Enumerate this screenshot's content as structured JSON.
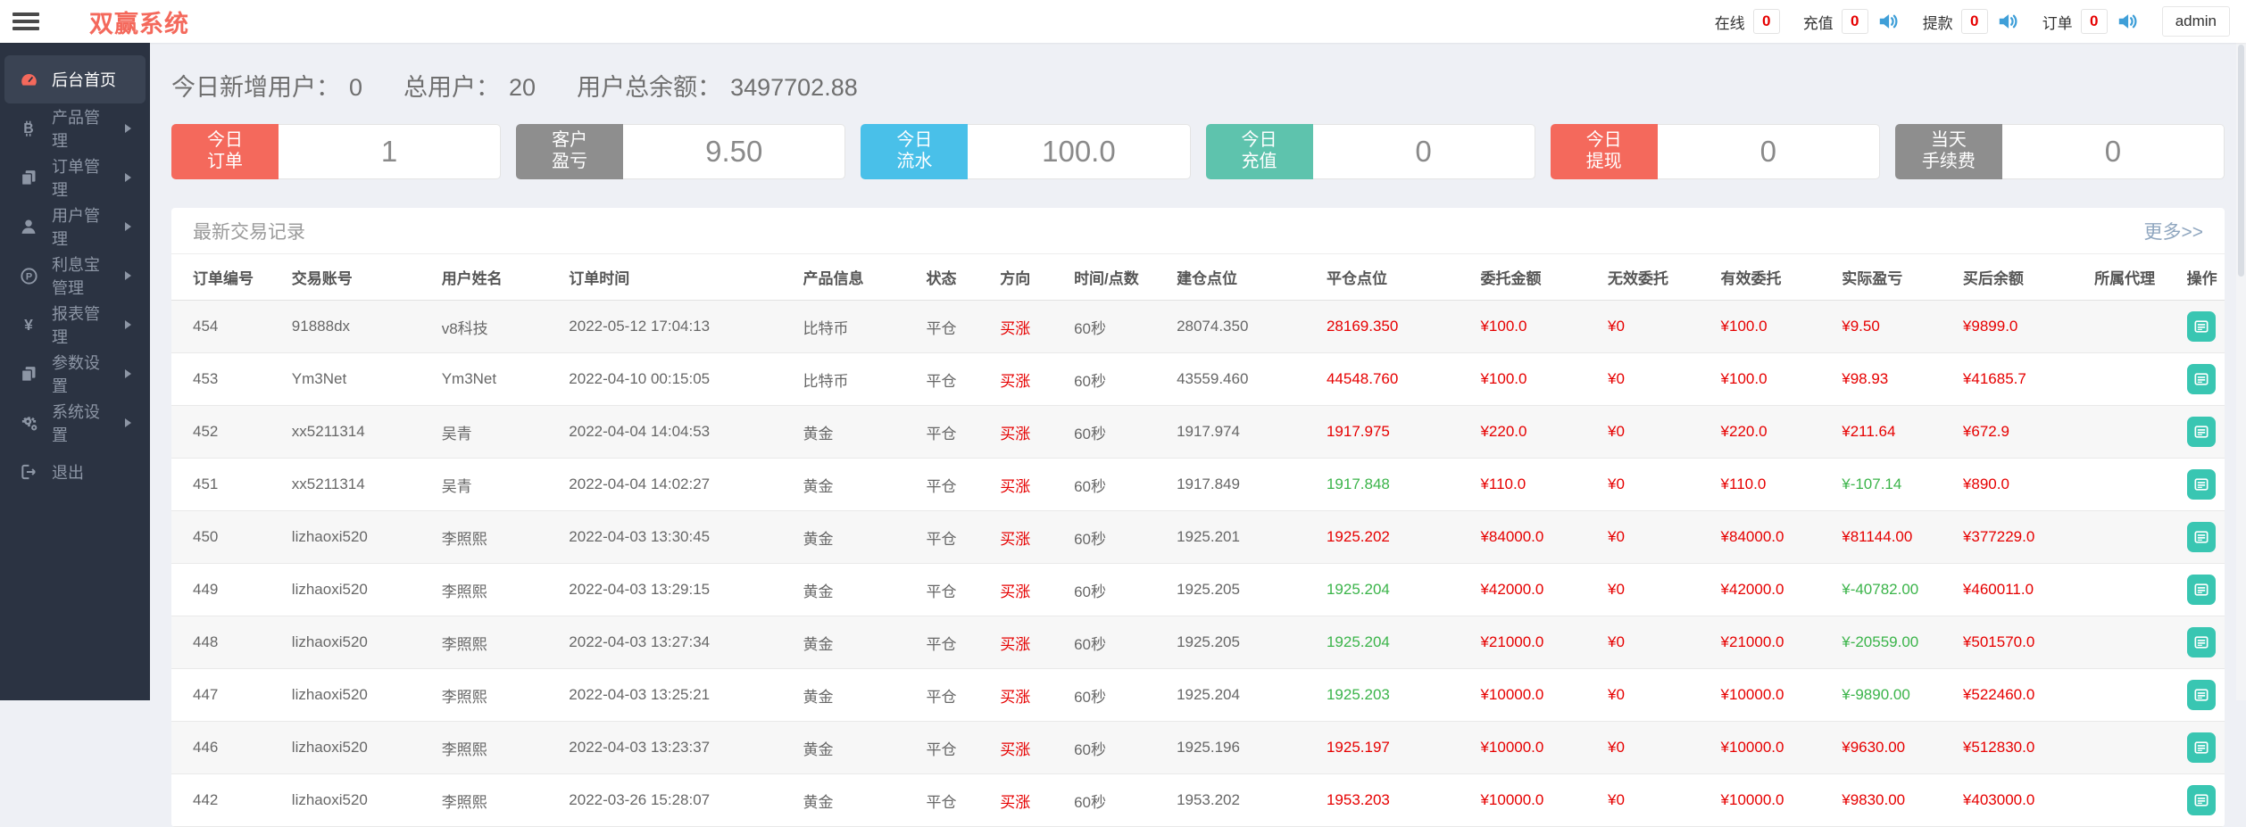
{
  "colors": {
    "brand_red": "#f4695c",
    "text_red": "#e60000",
    "text_green": "#3bb44a",
    "action_teal": "#39c6b2",
    "card_blue": "#49c0e9",
    "card_teal": "#5ec3ad",
    "card_gray": "#8e8e8e",
    "sidebar_bg": "#2b3342",
    "speaker_blue": "#3f9fd8"
  },
  "header": {
    "brand": "双赢系统",
    "stats": [
      {
        "label": "在线",
        "value": "0",
        "speaker": false
      },
      {
        "label": "充值",
        "value": "0",
        "speaker": true
      },
      {
        "label": "提款",
        "value": "0",
        "speaker": true
      },
      {
        "label": "订单",
        "value": "0",
        "speaker": true
      }
    ],
    "user": "admin"
  },
  "sidebar": {
    "items": [
      {
        "label": "后台首页",
        "icon": "dashboard-icon",
        "active": true,
        "arrow": false
      },
      {
        "label": "产品管理",
        "icon": "bitcoin-icon",
        "active": false,
        "arrow": true
      },
      {
        "label": "订单管理",
        "icon": "orders-icon",
        "active": false,
        "arrow": true
      },
      {
        "label": "用户管理",
        "icon": "user-icon",
        "active": false,
        "arrow": true
      },
      {
        "label": "利息宝管理",
        "icon": "interest-icon",
        "active": false,
        "arrow": true
      },
      {
        "label": "报表管理",
        "icon": "yen-icon",
        "active": false,
        "arrow": true
      },
      {
        "label": "参数设置",
        "icon": "params-icon",
        "active": false,
        "arrow": true
      },
      {
        "label": "系统设置",
        "icon": "gears-icon",
        "active": false,
        "arrow": true
      },
      {
        "label": "退出",
        "icon": "logout-icon",
        "active": false,
        "arrow": false
      }
    ]
  },
  "summary": {
    "new_users_label": "今日新增用户：",
    "new_users": "0",
    "total_users_label": "总用户：",
    "total_users": "20",
    "total_balance_label": "用户总余额：",
    "total_balance": "3497702.88"
  },
  "cards": [
    {
      "label_line1": "今日",
      "label_line2": "订单",
      "value": "1",
      "color": "#f4695c"
    },
    {
      "label_line1": "客户",
      "label_line2": "盈亏",
      "value": "9.50",
      "color": "#8e8e8e"
    },
    {
      "label_line1": "今日",
      "label_line2": "流水",
      "value": "100.0",
      "color": "#49c0e9"
    },
    {
      "label_line1": "今日",
      "label_line2": "充值",
      "value": "0",
      "color": "#5ec3ad"
    },
    {
      "label_line1": "今日",
      "label_line2": "提现",
      "value": "0",
      "color": "#f4695c"
    },
    {
      "label_line1": "当天",
      "label_line2": "手续费",
      "value": "0",
      "color": "#8e8e8e"
    }
  ],
  "panel": {
    "title": "最新交易记录",
    "more": "更多>>",
    "columns": [
      "订单编号",
      "交易账号",
      "用户姓名",
      "订单时间",
      "产品信息",
      "状态",
      "方向",
      "时间/点数",
      "建仓点位",
      "平仓点位",
      "委托金额",
      "无效委托",
      "有效委托",
      "实际盈亏",
      "买后余额",
      "所属代理",
      "操作"
    ],
    "rows": [
      {
        "id": "454",
        "account": "91888dx",
        "name": "v8科技",
        "time": "2022-05-12 17:04:13",
        "product": "比特币",
        "status": "平仓",
        "direction": "买涨",
        "period": "60秒",
        "open": "28074.350",
        "close": "28169.350",
        "close_color": "red",
        "amount": "¥100.0",
        "invalid": "¥0",
        "valid": "¥100.0",
        "profit": "¥9.50",
        "profit_color": "red",
        "balance": "¥9899.0",
        "agent": ""
      },
      {
        "id": "453",
        "account": "Ym3Net",
        "name": "Ym3Net",
        "time": "2022-04-10 00:15:05",
        "product": "比特币",
        "status": "平仓",
        "direction": "买涨",
        "period": "60秒",
        "open": "43559.460",
        "close": "44548.760",
        "close_color": "red",
        "amount": "¥100.0",
        "invalid": "¥0",
        "valid": "¥100.0",
        "profit": "¥98.93",
        "profit_color": "red",
        "balance": "¥41685.7",
        "agent": ""
      },
      {
        "id": "452",
        "account": "xx5211314",
        "name": "吴青",
        "time": "2022-04-04 14:04:53",
        "product": "黄金",
        "status": "平仓",
        "direction": "买涨",
        "period": "60秒",
        "open": "1917.974",
        "close": "1917.975",
        "close_color": "red",
        "amount": "¥220.0",
        "invalid": "¥0",
        "valid": "¥220.0",
        "profit": "¥211.64",
        "profit_color": "red",
        "balance": "¥672.9",
        "agent": ""
      },
      {
        "id": "451",
        "account": "xx5211314",
        "name": "吴青",
        "time": "2022-04-04 14:02:27",
        "product": "黄金",
        "status": "平仓",
        "direction": "买涨",
        "period": "60秒",
        "open": "1917.849",
        "close": "1917.848",
        "close_color": "green",
        "amount": "¥110.0",
        "invalid": "¥0",
        "valid": "¥110.0",
        "profit": "¥-107.14",
        "profit_color": "green",
        "balance": "¥890.0",
        "agent": ""
      },
      {
        "id": "450",
        "account": "lizhaoxi520",
        "name": "李照熙",
        "time": "2022-04-03 13:30:45",
        "product": "黄金",
        "status": "平仓",
        "direction": "买涨",
        "period": "60秒",
        "open": "1925.201",
        "close": "1925.202",
        "close_color": "red",
        "amount": "¥84000.0",
        "invalid": "¥0",
        "valid": "¥84000.0",
        "profit": "¥81144.00",
        "profit_color": "red",
        "balance": "¥377229.0",
        "agent": ""
      },
      {
        "id": "449",
        "account": "lizhaoxi520",
        "name": "李照熙",
        "time": "2022-04-03 13:29:15",
        "product": "黄金",
        "status": "平仓",
        "direction": "买涨",
        "period": "60秒",
        "open": "1925.205",
        "close": "1925.204",
        "close_color": "green",
        "amount": "¥42000.0",
        "invalid": "¥0",
        "valid": "¥42000.0",
        "profit": "¥-40782.00",
        "profit_color": "green",
        "balance": "¥460011.0",
        "agent": ""
      },
      {
        "id": "448",
        "account": "lizhaoxi520",
        "name": "李照熙",
        "time": "2022-04-03 13:27:34",
        "product": "黄金",
        "status": "平仓",
        "direction": "买涨",
        "period": "60秒",
        "open": "1925.205",
        "close": "1925.204",
        "close_color": "green",
        "amount": "¥21000.0",
        "invalid": "¥0",
        "valid": "¥21000.0",
        "profit": "¥-20559.00",
        "profit_color": "green",
        "balance": "¥501570.0",
        "agent": ""
      },
      {
        "id": "447",
        "account": "lizhaoxi520",
        "name": "李照熙",
        "time": "2022-04-03 13:25:21",
        "product": "黄金",
        "status": "平仓",
        "direction": "买涨",
        "period": "60秒",
        "open": "1925.204",
        "close": "1925.203",
        "close_color": "green",
        "amount": "¥10000.0",
        "invalid": "¥0",
        "valid": "¥10000.0",
        "profit": "¥-9890.00",
        "profit_color": "green",
        "balance": "¥522460.0",
        "agent": ""
      },
      {
        "id": "446",
        "account": "lizhaoxi520",
        "name": "李照熙",
        "time": "2022-04-03 13:23:37",
        "product": "黄金",
        "status": "平仓",
        "direction": "买涨",
        "period": "60秒",
        "open": "1925.196",
        "close": "1925.197",
        "close_color": "red",
        "amount": "¥10000.0",
        "invalid": "¥0",
        "valid": "¥10000.0",
        "profit": "¥9630.00",
        "profit_color": "red",
        "balance": "¥512830.0",
        "agent": ""
      },
      {
        "id": "442",
        "account": "lizhaoxi520",
        "name": "李照熙",
        "time": "2022-03-26 15:28:07",
        "product": "黄金",
        "status": "平仓",
        "dire向": "",
        "direction": "买涨",
        "period": "60秒",
        "open": "1953.202",
        "close": "1953.203",
        "close_color": "red",
        "amount": "¥10000.0",
        "invalid": "¥0",
        "valid": "¥10000.0",
        "profit": "¥9830.00",
        "profit_color": "red",
        "balance": "¥403000.0",
        "agent": ""
      }
    ]
  }
}
